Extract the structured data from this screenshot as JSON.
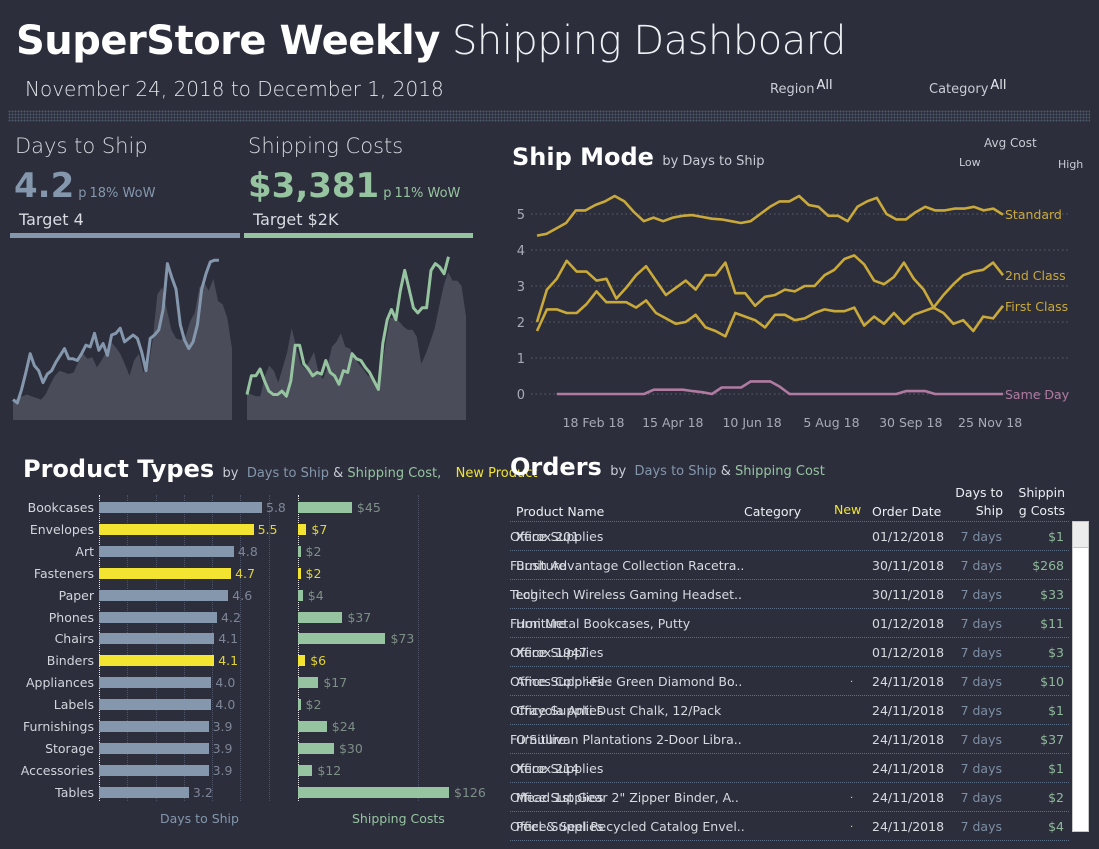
{
  "header": {
    "title_bold": "SuperStore Weekly",
    "title_light": "Shipping Dashboard",
    "date_range": "November 24, 2018 to December 1, 2018",
    "filters": [
      {
        "label": "Region",
        "value": "All"
      },
      {
        "label": "Category",
        "value": "All"
      }
    ]
  },
  "colors": {
    "background": "#2c2e3c",
    "days": "#8497ac",
    "cost": "#97c4a0",
    "new_product": "#f2e431",
    "ship_mode": "#c9a93a",
    "same_day": "#b07aa1",
    "area": "#4a4c5a"
  },
  "kpis": {
    "days": {
      "label": "Days to Ship",
      "value": "4.2",
      "wow_arrow": "p",
      "wow": "18% WoW",
      "target": "Target 4"
    },
    "cost": {
      "label": "Shipping Costs",
      "value": "$3,381",
      "wow_arrow": "p",
      "wow": "11% WoW",
      "target": "Target $2K"
    }
  },
  "sparklines": {
    "days": {
      "line": [
        1.2,
        1.0,
        1.8,
        2.8,
        3.9,
        3.2,
        2.9,
        2.2,
        2.7,
        2.9,
        3.4,
        3.8,
        4.2,
        3.6,
        3.6,
        3.5,
        3.9,
        4.4,
        4.3,
        5.1,
        4.1,
        4.5,
        3.8,
        5.0,
        5.1,
        5.4,
        4.6,
        4.8,
        5.0,
        4.8,
        4.0,
        2.9,
        4.8,
        5.0,
        5.3,
        6.5,
        9.2,
        8.4,
        7.7,
        5.6,
        4.7,
        4.2,
        4.6,
        5.6,
        7.7,
        8.6,
        9.3,
        9.4,
        9.4
      ],
      "area": [
        1.1,
        1.3,
        1.4,
        1.5,
        1.4,
        1.3,
        1.2,
        1.5,
        2.1,
        2.6,
        2.9,
        2.8,
        2.7,
        2.8,
        3.4,
        3.9,
        3.6,
        3.7,
        3.1,
        3.5,
        4.0,
        4.6,
        4.3,
        3.9,
        3.3,
        2.6,
        3.5,
        3.9,
        2.8,
        3.0,
        4.8,
        7.4,
        7.8,
        6.5,
        5.3,
        4.8,
        4.7,
        4.9,
        5.8,
        6.3,
        7.8,
        8.1,
        7.6,
        8.3,
        7.0,
        6.8,
        6.0,
        4.2
      ]
    },
    "cost": {
      "line": [
        1.5,
        2.6,
        2.6,
        3.0,
        2.3,
        1.7,
        1.5,
        1.5,
        1.7,
        1.4,
        2.3,
        4.4,
        4.4,
        3.3,
        3.0,
        2.6,
        2.8,
        2.7,
        3.5,
        2.8,
        2.6,
        2.1,
        2.9,
        2.8,
        3.9,
        3.6,
        3.5,
        3.1,
        2.8,
        2.3,
        1.8,
        4.5,
        5.9,
        6.5,
        5.9,
        7.6,
        8.8,
        7.7,
        6.6,
        6.3,
        6.6,
        6.6,
        8.8,
        9.2,
        9.0,
        8.6,
        9.6
      ],
      "area": [
        1.6,
        1.5,
        1.4,
        1.4,
        2.6,
        3.2,
        2.9,
        2.2,
        3.1,
        4.0,
        5.4,
        4.3,
        3.3,
        3.0,
        3.5,
        4.0,
        2.8,
        2.4,
        3.1,
        4.3,
        4.6,
        5.1,
        4.3,
        4.2,
        3.7,
        3.3,
        3.0,
        2.6,
        2.5,
        1.8,
        2.7,
        4.5,
        6.0,
        6.0,
        5.8,
        5.5,
        5.3,
        5.3,
        4.9,
        3.3,
        3.9,
        4.6,
        5.4,
        6.7,
        7.9,
        8.7,
        8.2,
        8.2,
        7.9,
        6.1
      ]
    }
  },
  "ship_mode": {
    "title": "Ship Mode",
    "subtitle": "by Days to Ship",
    "legend": {
      "title": "Avg Cost",
      "low": "Low",
      "high": "High"
    },
    "chart_data": {
      "type": "line",
      "title": "Ship Mode by Days to Ship",
      "xlabel": "",
      "ylabel": "Days to Ship",
      "ylim": [
        0,
        5.5
      ],
      "y_ticks": [
        "0",
        "1",
        "2",
        "3",
        "4",
        "5"
      ],
      "x_ticks": [
        "18 Feb 18",
        "15 Apr 18",
        "10 Jun 18",
        "5 Aug 18",
        "30 Sep 18",
        "25 Nov 18"
      ],
      "x_tick_positions": [
        6,
        14,
        22,
        30,
        38,
        46
      ],
      "n_weeks": 48,
      "series": [
        {
          "name": "Standard",
          "values": [
            4.4,
            4.45,
            4.6,
            4.75,
            5.1,
            5.1,
            5.25,
            5.35,
            5.5,
            5.35,
            5.05,
            4.8,
            4.9,
            4.8,
            4.9,
            4.95,
            4.97,
            4.92,
            4.87,
            4.85,
            4.8,
            4.75,
            4.8,
            5.0,
            5.2,
            5.35,
            5.35,
            5.5,
            5.25,
            5.2,
            4.95,
            4.95,
            4.8,
            5.2,
            5.35,
            5.45,
            5.0,
            4.85,
            4.85,
            5.05,
            5.2,
            5.1,
            5.1,
            5.15,
            5.15,
            5.2,
            5.1,
            5.15,
            4.98
          ]
        },
        {
          "name": "2nd Class",
          "values": [
            2.0,
            2.9,
            3.2,
            3.7,
            3.4,
            3.4,
            3.15,
            3.2,
            2.65,
            2.95,
            3.3,
            3.55,
            3.15,
            2.75,
            2.95,
            3.15,
            2.9,
            3.3,
            3.3,
            3.65,
            2.8,
            2.8,
            2.45,
            2.7,
            2.75,
            2.9,
            2.85,
            3.0,
            3.0,
            3.3,
            3.45,
            3.75,
            3.85,
            3.6,
            3.15,
            3.05,
            3.25,
            3.65,
            3.2,
            2.9,
            2.4,
            2.75,
            3.05,
            3.3,
            3.4,
            3.45,
            3.65,
            3.3
          ]
        },
        {
          "name": "First Class",
          "values": [
            1.75,
            2.35,
            2.35,
            2.25,
            2.25,
            2.5,
            2.85,
            2.55,
            2.55,
            2.55,
            2.4,
            2.6,
            2.25,
            2.1,
            1.95,
            2.0,
            2.2,
            1.85,
            1.75,
            1.6,
            2.25,
            2.15,
            2.05,
            1.85,
            2.2,
            2.2,
            2.05,
            2.1,
            2.25,
            2.35,
            2.3,
            2.3,
            2.4,
            1.9,
            2.15,
            1.95,
            2.25,
            1.95,
            2.2,
            2.3,
            2.4,
            2.25,
            1.95,
            2.05,
            1.75,
            2.15,
            2.1,
            2.45
          ]
        },
        {
          "name": "Same Day",
          "start_index": 2,
          "values": [
            0,
            0,
            0,
            0,
            0,
            0,
            0,
            0,
            0,
            0,
            0.12,
            0.12,
            0.12,
            0.12,
            0.08,
            0.05,
            0.0,
            0.18,
            0.18,
            0.18,
            0.35,
            0.35,
            0.35,
            0.2,
            0.0,
            0.0,
            0,
            0,
            0,
            0,
            0,
            0,
            0,
            0,
            0,
            0,
            0.08,
            0.08,
            0.08,
            0.0,
            0,
            0,
            0,
            0,
            0,
            0,
            0
          ]
        }
      ]
    }
  },
  "product_types": {
    "title": "Product Types",
    "sub_by": "by",
    "sub_days": "Days to Ship",
    "sub_amp": "&",
    "sub_cost": "Shipping Cost,",
    "sub_new": "New Product",
    "axis_days": "Days to Ship",
    "axis_cost": "Shipping Costs",
    "chart_data": {
      "type": "bar",
      "orientation": "horizontal",
      "categories": [
        "Bookcases",
        "Envelopes",
        "Art",
        "Fasteners",
        "Paper",
        "Phones",
        "Chairs",
        "Binders",
        "Appliances",
        "Labels",
        "Furnishings",
        "Storage",
        "Accessories",
        "Tables"
      ],
      "new_product": [
        false,
        true,
        false,
        true,
        false,
        false,
        false,
        true,
        false,
        false,
        false,
        false,
        false,
        false
      ],
      "series": [
        {
          "name": "Days to Ship",
          "values": [
            5.8,
            5.5,
            4.8,
            4.7,
            4.6,
            4.2,
            4.1,
            4.1,
            4.0,
            4.0,
            3.9,
            3.9,
            3.9,
            3.2
          ],
          "labels": [
            "5.8",
            "5.5",
            "4.8",
            "4.7",
            "4.6",
            "4.2",
            "4.1",
            "4.1",
            "4.0",
            "4.0",
            "3.9",
            "3.9",
            "3.9",
            "3.2"
          ],
          "xlim": [
            0,
            7
          ]
        },
        {
          "name": "Shipping Costs",
          "values": [
            45,
            7,
            2,
            2,
            4,
            37,
            73,
            6,
            17,
            2,
            24,
            30,
            12,
            126
          ],
          "labels": [
            "$45",
            "$7",
            "$2",
            "$2",
            "$4",
            "$37",
            "$73",
            "$6",
            "$17",
            "$2",
            "$24",
            "$30",
            "$12",
            "$126"
          ],
          "xlim": [
            0,
            126
          ]
        }
      ]
    }
  },
  "orders": {
    "title": "Orders",
    "sub_by": "by",
    "sub_days": "Days to Ship",
    "sub_amp": "&",
    "sub_cost": "Shipping Cost",
    "columns": {
      "name": "Product Name",
      "category": "Category",
      "new": "New",
      "date": "Order Date",
      "days_1": "Days to",
      "days_2": "Ship",
      "cost_1": "Shippin",
      "cost_2": "g Costs"
    },
    "rows": [
      {
        "name": "Xerox 201",
        "category": "Office Supplies",
        "new": "",
        "date": "01/12/2018",
        "days": "7 days",
        "cost": "$1"
      },
      {
        "name": "Bush Advantage Collection Racetra..",
        "category": "Furniture",
        "new": "",
        "date": "30/11/2018",
        "days": "7 days",
        "cost": "$268"
      },
      {
        "name": "Logitech Wireless Gaming Headset..",
        "category": "Tech",
        "new": "",
        "date": "30/11/2018",
        "days": "7 days",
        "cost": "$33"
      },
      {
        "name": "Hon Metal Bookcases, Putty",
        "category": "Furniture",
        "new": "",
        "date": "01/12/2018",
        "days": "7 days",
        "cost": "$11"
      },
      {
        "name": "Xerox 1947",
        "category": "Office Supplies",
        "new": "",
        "date": "01/12/2018",
        "days": "7 days",
        "cost": "$3"
      },
      {
        "name": "Ames Color-File Green Diamond Bo..",
        "category": "Office Supplies",
        "new": ".",
        "date": "24/11/2018",
        "days": "7 days",
        "cost": "$10"
      },
      {
        "name": "Crayola Anti Dust Chalk, 12/Pack",
        "category": "Office Supplies",
        "new": "",
        "date": "24/11/2018",
        "days": "7 days",
        "cost": "$1"
      },
      {
        "name": "O'Sullivan Plantations 2-Door Libra..",
        "category": "Furniture",
        "new": "",
        "date": "24/11/2018",
        "days": "7 days",
        "cost": "$37"
      },
      {
        "name": "Xerox 214",
        "category": "Office Supplies",
        "new": "",
        "date": "24/11/2018",
        "days": "7 days",
        "cost": "$1"
      },
      {
        "name": "Mead 1st Gear 2\" Zipper Binder, A..",
        "category": "Office Supplies",
        "new": ".",
        "date": "24/11/2018",
        "days": "7 days",
        "cost": "$2"
      },
      {
        "name": "Peel & Seel Recycled Catalog Envel..",
        "category": "Office Supplies",
        "new": ".",
        "date": "24/11/2018",
        "days": "7 days",
        "cost": "$4"
      }
    ]
  }
}
